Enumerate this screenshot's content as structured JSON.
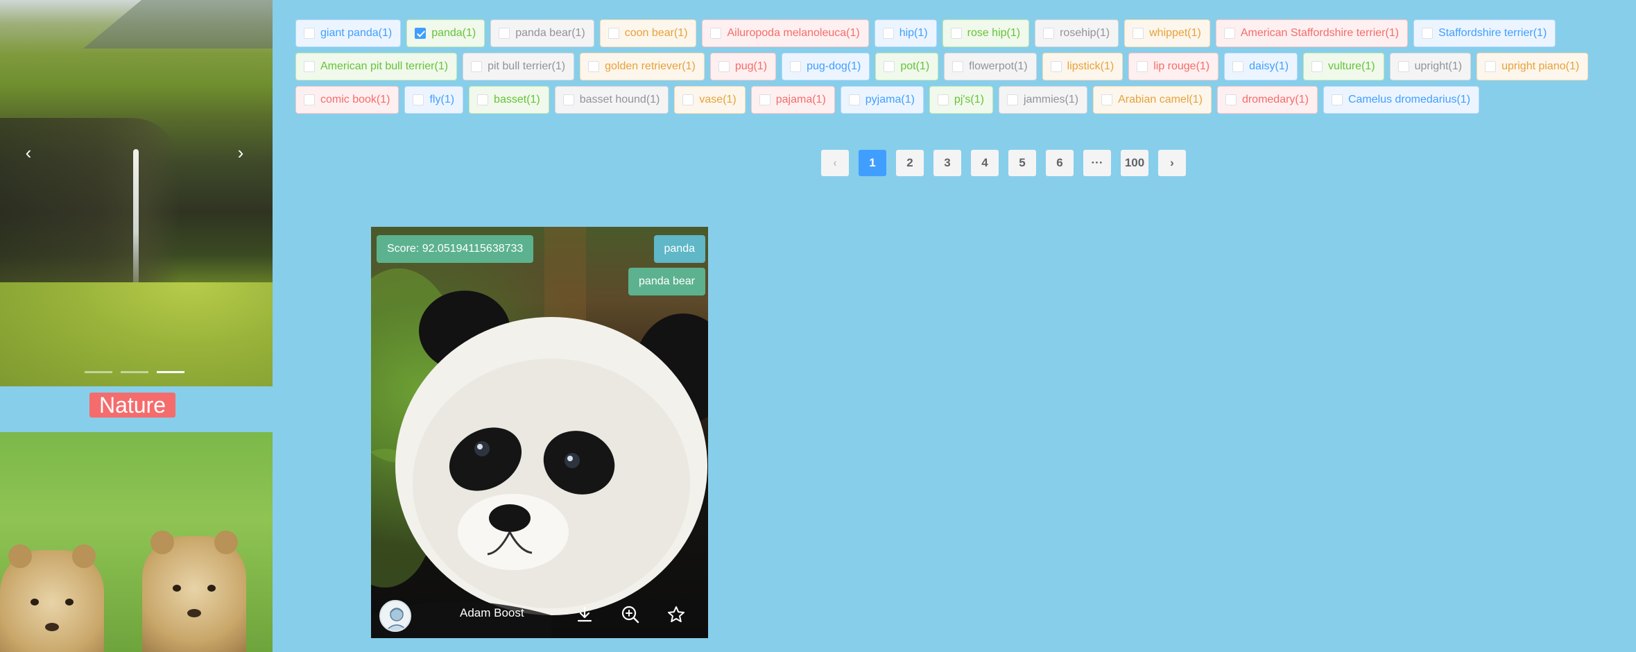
{
  "sidebar": {
    "carousel": {
      "prev_icon": "chevron-left-icon",
      "next_icon": "chevron-right-icon",
      "prev_glyph": "‹",
      "next_glyph": "›",
      "indicator_count": 3,
      "active_indicator": 3
    },
    "category_label": "Nature"
  },
  "tags": [
    {
      "label": "giant panda(1)",
      "type": "primary",
      "checked": false
    },
    {
      "label": "panda(1)",
      "type": "success",
      "checked": true
    },
    {
      "label": "panda bear(1)",
      "type": "info",
      "checked": false
    },
    {
      "label": "coon bear(1)",
      "type": "warning",
      "checked": false
    },
    {
      "label": "Ailuropoda melanoleuca(1)",
      "type": "danger",
      "checked": false
    },
    {
      "label": "hip(1)",
      "type": "primary",
      "checked": false
    },
    {
      "label": "rose hip(1)",
      "type": "success",
      "checked": false
    },
    {
      "label": "rosehip(1)",
      "type": "info",
      "checked": false
    },
    {
      "label": "whippet(1)",
      "type": "warning",
      "checked": false
    },
    {
      "label": "American Staffordshire terrier(1)",
      "type": "danger",
      "checked": false
    },
    {
      "label": "Staffordshire terrier(1)",
      "type": "primary",
      "checked": false
    },
    {
      "label": "American pit bull terrier(1)",
      "type": "success",
      "checked": false
    },
    {
      "label": "pit bull terrier(1)",
      "type": "info",
      "checked": false
    },
    {
      "label": "golden retriever(1)",
      "type": "warning",
      "checked": false
    },
    {
      "label": "pug(1)",
      "type": "danger",
      "checked": false
    },
    {
      "label": "pug-dog(1)",
      "type": "primary",
      "checked": false
    },
    {
      "label": "pot(1)",
      "type": "success",
      "checked": false
    },
    {
      "label": "flowerpot(1)",
      "type": "info",
      "checked": false
    },
    {
      "label": "lipstick(1)",
      "type": "warning",
      "checked": false
    },
    {
      "label": "lip rouge(1)",
      "type": "danger",
      "checked": false
    },
    {
      "label": "daisy(1)",
      "type": "primary",
      "checked": false
    },
    {
      "label": "vulture(1)",
      "type": "success",
      "checked": false
    },
    {
      "label": "upright(1)",
      "type": "info",
      "checked": false
    },
    {
      "label": "upright piano(1)",
      "type": "warning",
      "checked": false
    },
    {
      "label": "comic book(1)",
      "type": "danger",
      "checked": false
    },
    {
      "label": "fly(1)",
      "type": "primary",
      "checked": false
    },
    {
      "label": "basset(1)",
      "type": "success",
      "checked": false
    },
    {
      "label": "basset hound(1)",
      "type": "info",
      "checked": false
    },
    {
      "label": "vase(1)",
      "type": "warning",
      "checked": false
    },
    {
      "label": "pajama(1)",
      "type": "danger",
      "checked": false
    },
    {
      "label": "pyjama(1)",
      "type": "primary",
      "checked": false
    },
    {
      "label": "pj's(1)",
      "type": "success",
      "checked": false
    },
    {
      "label": "jammies(1)",
      "type": "info",
      "checked": false
    },
    {
      "label": "Arabian camel(1)",
      "type": "warning",
      "checked": false
    },
    {
      "label": "dromedary(1)",
      "type": "danger",
      "checked": false
    },
    {
      "label": "Camelus dromedarius(1)",
      "type": "primary",
      "checked": false
    }
  ],
  "pagination": {
    "prev_glyph": "‹",
    "next_glyph": "›",
    "pages": [
      "1",
      "2",
      "3",
      "4",
      "5",
      "6"
    ],
    "ellipsis": "···",
    "last_page": "100",
    "current": "1"
  },
  "card": {
    "score": "Score: 92.05194115638733",
    "labels": [
      "panda",
      "panda bear"
    ],
    "author": "Adam Boost",
    "icons": [
      "download-icon",
      "zoom-in-icon",
      "star-icon"
    ]
  },
  "colors": {
    "background": "#87CEEB",
    "primary": "#409EFF",
    "success": "#67C23A",
    "info": "#909399",
    "warning": "#E6A23C",
    "danger": "#F56C6C",
    "score_badge": "#5cb28f",
    "label_tag_1": "#5fb7c7",
    "label_tag_2": "#5cb28f"
  }
}
